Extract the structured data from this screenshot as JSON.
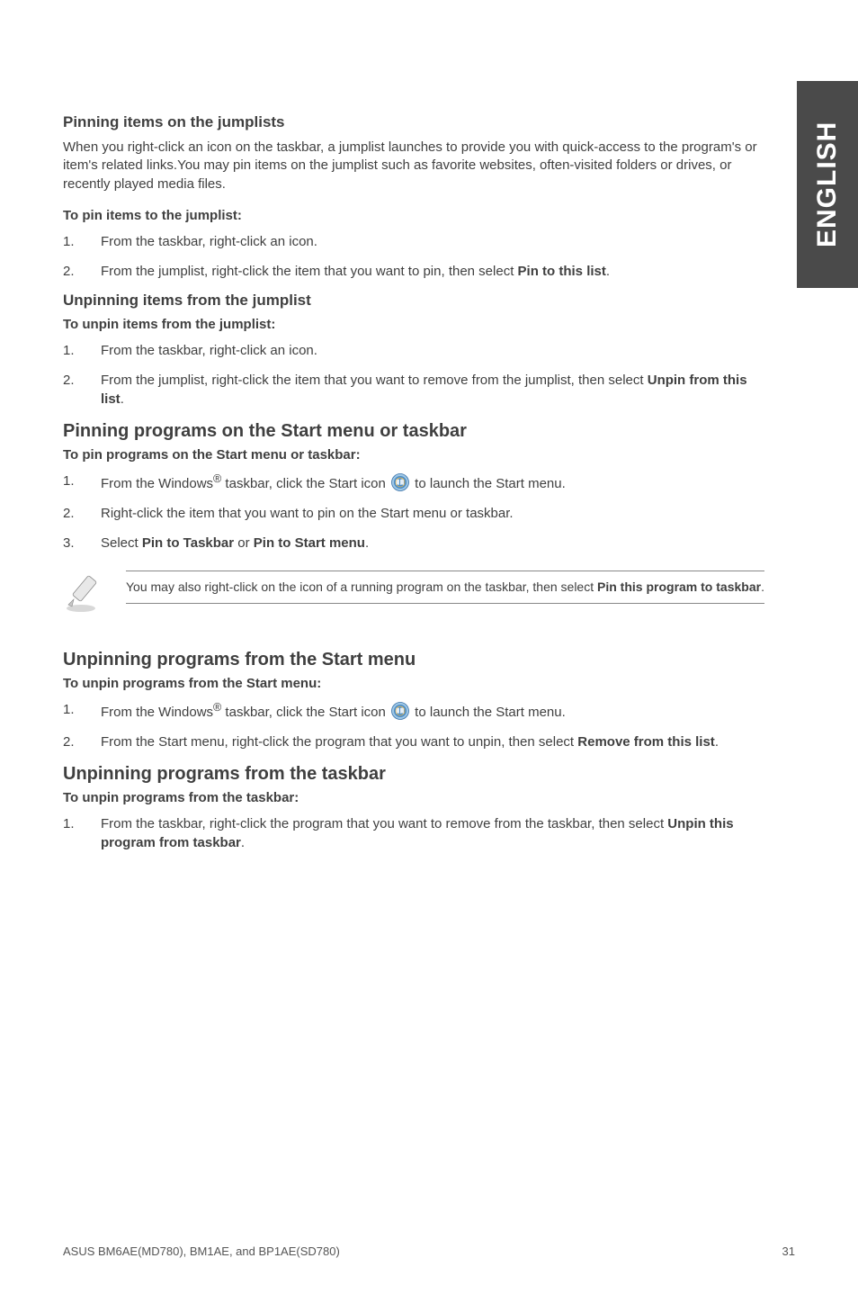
{
  "sideTab": "ENGLISH",
  "sec1": {
    "subhead": "Pinning items on the jumplists",
    "intro": "When you right-click an icon on the taskbar, a jumplist launches to provide you with quick-access to the program's or item's related links.You may pin items on the jumplist such as favorite websites, often-visited folders or drives, or recently played media files.",
    "procTitle": "To pin items to the jumplist:",
    "step1": "From the taskbar, right-click an icon.",
    "step2_a": "From the jumplist, right-click the item that you want to pin, then select ",
    "step2_b": "Pin to this list",
    "step2_c": "."
  },
  "sec2": {
    "subhead": "Unpinning items from the jumplist",
    "procTitle": "To unpin items from the jumplist:",
    "step1": "From the taskbar, right-click an icon.",
    "step2_a": "From the jumplist, right-click the item that you want to remove from the jumplist, then select ",
    "step2_b": "Unpin from this list",
    "step2_c": "."
  },
  "sec3": {
    "section": "Pinning programs on the Start menu or taskbar",
    "procTitle": "To pin programs on the Start menu or taskbar:",
    "step1_a": "From the Windows",
    "step1_b": " taskbar, click the Start icon ",
    "step1_c": " to launch the Start menu.",
    "step2": "Right-click the item that you want to pin on the Start menu or taskbar.",
    "step3_a": "Select ",
    "step3_b": "Pin to Taskbar",
    "step3_c": " or ",
    "step3_d": "Pin to Start menu",
    "step3_e": "."
  },
  "note": {
    "text_a": "You may also right-click on the icon of a running program on the taskbar, then select ",
    "text_b": "Pin this program to taskbar",
    "text_c": "."
  },
  "sec4": {
    "section": "Unpinning programs from the Start menu",
    "procTitle": "To unpin programs from the Start menu:",
    "step1_a": "From the Windows",
    "step1_b": " taskbar, click the Start icon ",
    "step1_c": " to launch the Start menu.",
    "step2_a": "From the Start menu, right-click the program that you want to unpin, then select ",
    "step2_b": "Remove from this list",
    "step2_c": "."
  },
  "sec5": {
    "section": "Unpinning programs from the taskbar",
    "procTitle": "To unpin programs from the taskbar:",
    "step1_a": "From the taskbar, right-click the program that you want to remove from the taskbar, then select ",
    "step1_b": "Unpin this program from taskbar",
    "step1_c": "."
  },
  "footer": {
    "left": "ASUS BM6AE(MD780), BM1AE, and BP1AE(SD780)",
    "right": "31"
  },
  "reg": "®"
}
